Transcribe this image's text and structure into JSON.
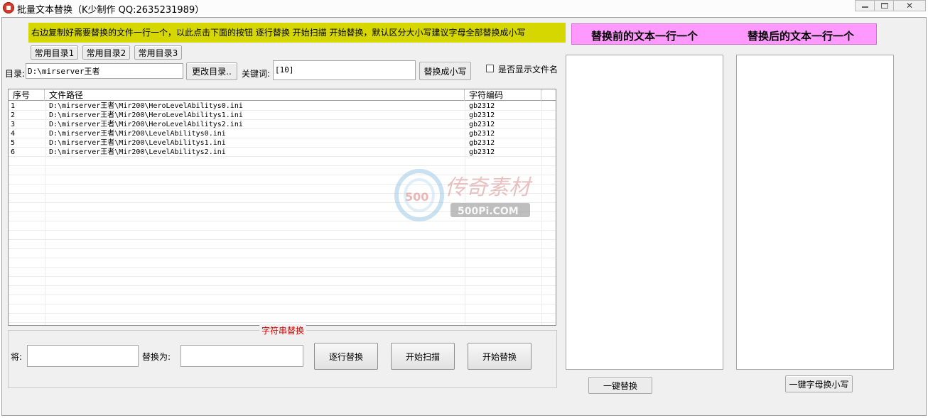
{
  "window": {
    "title": "批量文本替换（K少制作 QQ:2635231989）"
  },
  "banner": {
    "text": "右边复制好需要替换的文件一行一个，以此点击下面的按钮 逐行替换 开始扫描 开始替换，默认区分大小写建议字母全部替换成小写"
  },
  "presets": [
    "常用目录1",
    "常用目录2",
    "常用目录3"
  ],
  "dir": {
    "label": "目录:",
    "value": "D:\\mirserver王者",
    "change_button": "更改目录.."
  },
  "keyword": {
    "label": "关键词:",
    "value": "[10]"
  },
  "to_lowercase_button": "替换成小写",
  "show_filename": {
    "label": "是否显示文件名",
    "checked": false
  },
  "table": {
    "columns": [
      "序号",
      "文件路径",
      "字符编码"
    ],
    "rows": [
      [
        "1",
        "D:\\mirserver王者\\Mir200\\HeroLevelAbilitys0.ini",
        "gb2312"
      ],
      [
        "2",
        "D:\\mirserver王者\\Mir200\\HeroLevelAbilitys1.ini",
        "gb2312"
      ],
      [
        "3",
        "D:\\mirserver王者\\Mir200\\HeroLevelAbilitys2.ini",
        "gb2312"
      ],
      [
        "4",
        "D:\\mirserver王者\\Mir200\\LevelAbilitys0.ini",
        "gb2312"
      ],
      [
        "5",
        "D:\\mirserver王者\\Mir200\\LevelAbilitys1.ini",
        "gb2312"
      ],
      [
        "6",
        "D:\\mirserver王者\\Mir200\\LevelAbilitys2.ini",
        "gb2312"
      ]
    ]
  },
  "watermark": {
    "brand": "传奇素材",
    "site": "500Pi.COM",
    "badge": "500"
  },
  "replace_group": {
    "title": "字符串替换",
    "from_label": "将:",
    "from_value": "",
    "to_label": "替换为:",
    "to_value": "",
    "line_replace": "逐行替换",
    "start_scan": "开始扫描",
    "start_replace": "开始替换"
  },
  "right_panel": {
    "header_before": "替换前的文本一行一个",
    "header_after": "替换后的文本一行一个",
    "one_click_replace": "一键替换",
    "one_click_lower": "一键字母换小写",
    "header_color": "#ff99ff"
  },
  "colors": {
    "banner": "#d6d600",
    "group_title": "#d40000"
  }
}
